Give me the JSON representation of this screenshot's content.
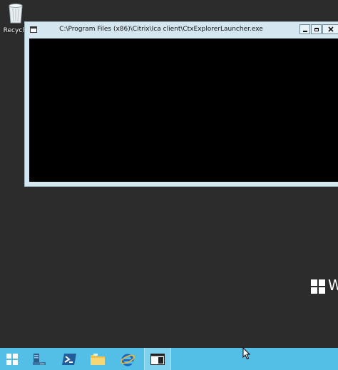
{
  "desktop": {
    "recycle_bin_label": "Recycle",
    "watermark_text": "W"
  },
  "window": {
    "title": "C:\\Program Files (x86)\\Citrix\\Ica client\\CtxExplorerLauncher.exe",
    "app_icon": "console-window-icon",
    "controls": [
      "minimize",
      "maximize",
      "close"
    ]
  },
  "taskbar": {
    "color": "#54bfe6",
    "items": [
      {
        "icon": "start-windows-icon"
      },
      {
        "icon": "server-manager-icon"
      },
      {
        "icon": "powershell-icon"
      },
      {
        "icon": "file-explorer-icon"
      },
      {
        "icon": "internet-explorer-icon"
      },
      {
        "icon": "console-app-icon",
        "active": true
      }
    ]
  }
}
